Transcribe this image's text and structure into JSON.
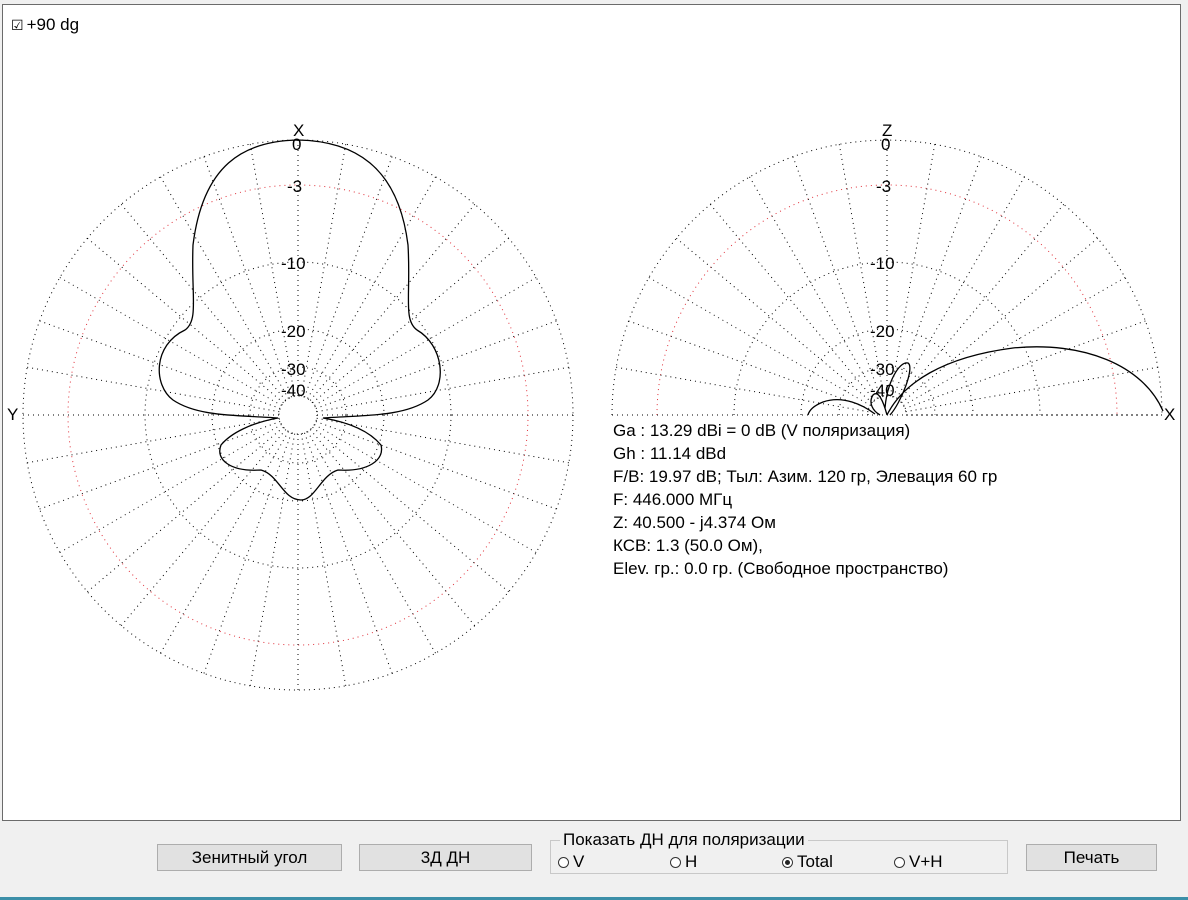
{
  "checkbox": {
    "glyph": "☑",
    "label": "+90 dg"
  },
  "azimuth_plot": {
    "axis_top": "X",
    "axis_left": "Y",
    "ring_labels": [
      "0",
      "-3",
      "-10",
      "-20",
      "-30",
      "-40"
    ]
  },
  "elevation_plot": {
    "axis_top": "Z",
    "axis_right": "X",
    "ring_labels": [
      "0",
      "-3",
      "-10",
      "-20",
      "-30",
      "-40"
    ]
  },
  "info_lines": [
    "Ga : 13.29 dBi = 0 dB  (V поляризация)",
    "Gh : 11.14 dBd",
    "F/B: 19.97 dB; Тыл: Азим. 120 гр, Элевация 60 гр",
    "F: 446.000 МГц",
    "Z: 40.500 - j4.374 Ом",
    "КСВ: 1.3 (50.0 Ом),",
    "Elev. гр.: 0.0 гр. (Свободное пространство)"
  ],
  "buttons": {
    "zenith": "Зенитный угол",
    "threed": "3Д   ДН",
    "print": "Печать"
  },
  "polarization": {
    "title": "Показать ДН для поляризации",
    "options": [
      "V",
      "H",
      "Total",
      "V+H"
    ],
    "selected": "Total"
  },
  "colors": {
    "grid": "#000000",
    "minus3_ring": "#e0303a",
    "pattern": "#000000",
    "accent_bar": "#3c8fa8"
  }
}
